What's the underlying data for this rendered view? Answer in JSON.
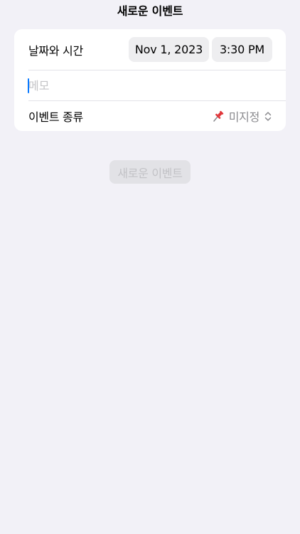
{
  "header": {
    "title": "새로운 이벤트"
  },
  "form": {
    "date_time": {
      "label": "날짜와 시간",
      "date_value": "Nov 1, 2023",
      "time_value": "3:30 PM"
    },
    "memo": {
      "value": "",
      "placeholder": "메모"
    },
    "event_type": {
      "label": "이벤트 종류",
      "icon": "pushpin-icon",
      "value": "미지정"
    }
  },
  "actions": {
    "create_label": "새로운 이벤트",
    "create_enabled": false
  },
  "colors": {
    "background": "#f2f1f7",
    "card": "#ffffff",
    "accent_caret": "#0a7aff",
    "pin_red": "#e0363a",
    "disabled_button": "#e2e2e6",
    "disabled_text": "#c2c2c6"
  }
}
